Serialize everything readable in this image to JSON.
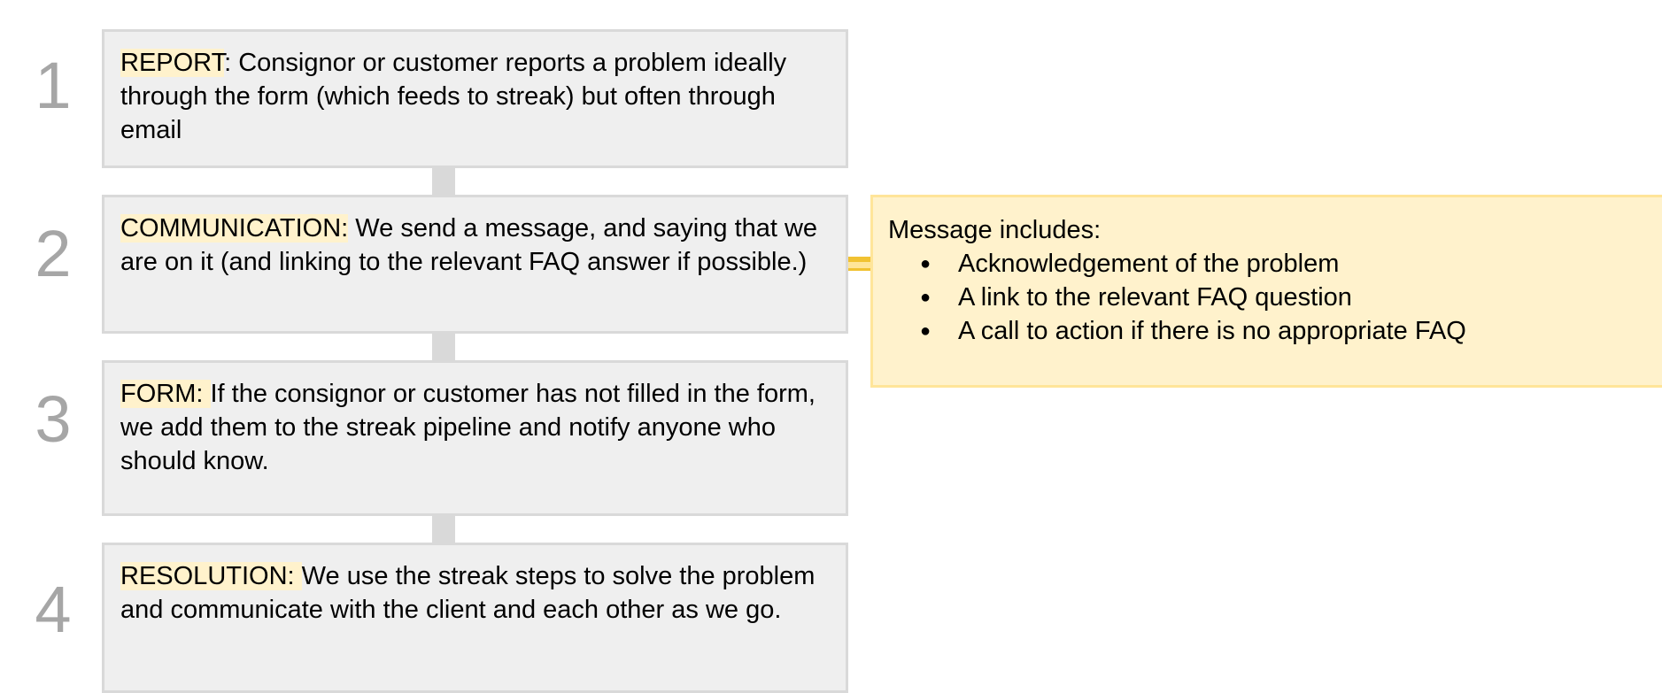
{
  "steps": [
    {
      "number": "1",
      "keyword": "REPORT",
      "text": ": Consignor or customer reports a problem ideally through the form (which feeds to streak) but often through email"
    },
    {
      "number": "2",
      "keyword": "COMMUNICATION:",
      "text": " We send a message, and saying that we are on it (and linking to the relevant FAQ answer if possible.)"
    },
    {
      "number": "3",
      "keyword": "FORM: ",
      "text": " If the consignor or customer has not filled in the form, we add them to the streak pipeline and notify anyone who should know."
    },
    {
      "number": "4",
      "keyword": "RESOLUTION: ",
      "text": " We use the streak steps to solve the problem and communicate with the client and each other as we go."
    }
  ],
  "callout": {
    "heading": "Message includes:",
    "bullet_char": "●",
    "items": [
      "Acknowledgement of the problem",
      "A link to the relevant FAQ question",
      "A call to action if there is no appropriate FAQ"
    ]
  },
  "colors": {
    "box_fill": "#efefef",
    "box_border": "#d9d9d9",
    "highlight": "#fff2cc",
    "callout_border": "#ffe599",
    "connector_accent": "#f1c232",
    "number_color": "#a6a6a6"
  }
}
